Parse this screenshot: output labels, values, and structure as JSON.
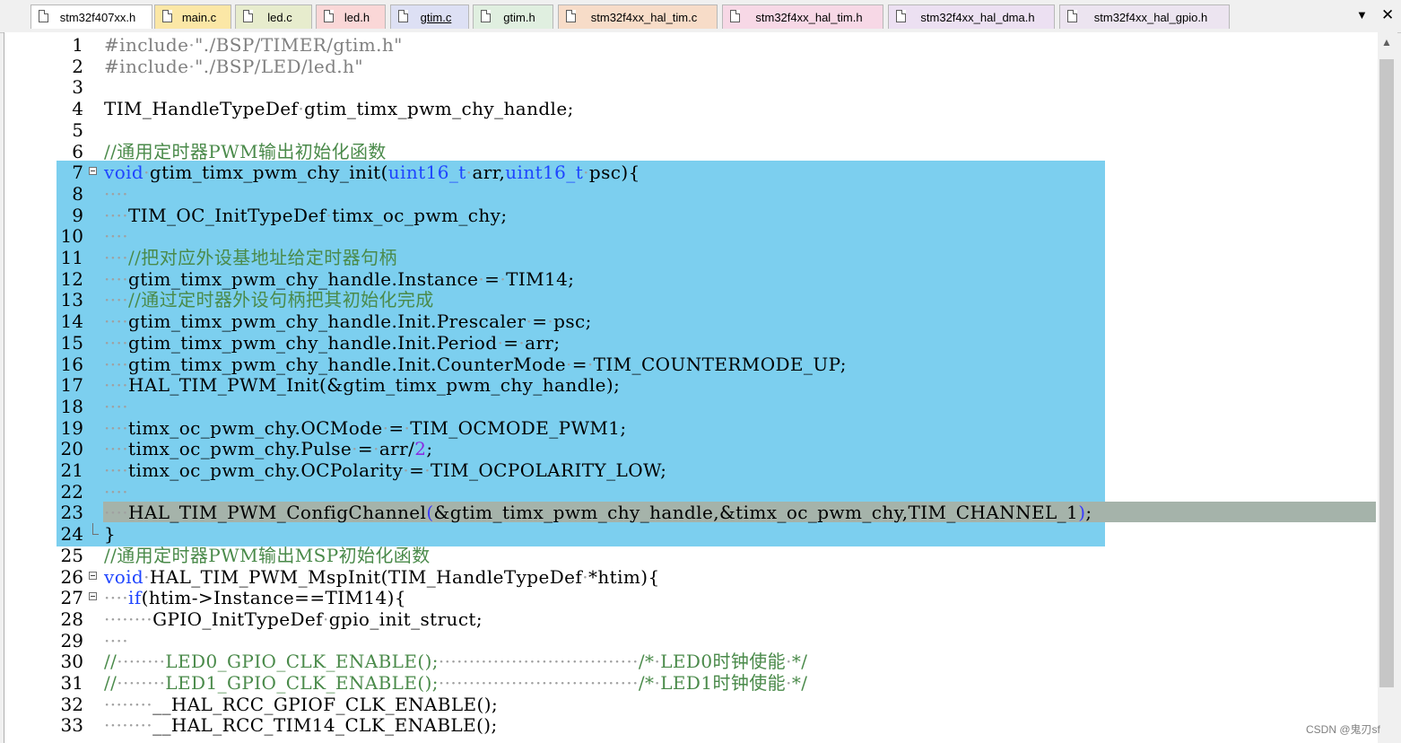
{
  "tabs": [
    {
      "label": "stm32f407xx.h",
      "color": "#ffffff",
      "active": false
    },
    {
      "label": "main.c",
      "color": "#fbe7a6",
      "active": false
    },
    {
      "label": "led.c",
      "color": "#e7eccd",
      "active": false
    },
    {
      "label": "led.h",
      "color": "#fad7d7",
      "active": false
    },
    {
      "label": "gtim.c",
      "color": "#dde0f4",
      "active": true
    },
    {
      "label": "gtim.h",
      "color": "#e0efe0",
      "active": false
    },
    {
      "label": "stm32f4xx_hal_tim.c",
      "color": "#f7dcc8",
      "active": false
    },
    {
      "label": "stm32f4xx_hal_tim.h",
      "color": "#f7d8e6",
      "active": false
    },
    {
      "label": "stm32f4xx_hal_dma.h",
      "color": "#ece0f2",
      "active": false
    },
    {
      "label": "stm32f4xx_hal_gpio.h",
      "color": "#ece4f0",
      "active": false
    }
  ],
  "tab_dropdown_icon": "chevron-down-icon",
  "tab_close_icon": "close-icon",
  "tab_dropdown_glyph": "▼",
  "tab_close_glyph": "✕",
  "line_numbers": [
    "1",
    "2",
    "3",
    "4",
    "5",
    "6",
    "7",
    "8",
    "9",
    "10",
    "11",
    "12",
    "13",
    "14",
    "15",
    "16",
    "17",
    "18",
    "19",
    "20",
    "21",
    "22",
    "23",
    "24",
    "25",
    "26",
    "27",
    "28",
    "29",
    "30",
    "31",
    "32",
    "33"
  ],
  "code_lines": [
    [
      {
        "t": "#include",
        "c": "pp"
      },
      {
        "t": "·",
        "c": "ws"
      },
      {
        "t": "\"./BSP/TIMER/gtim.h\"",
        "c": "str"
      }
    ],
    [
      {
        "t": "#include",
        "c": "pp"
      },
      {
        "t": "·",
        "c": "ws"
      },
      {
        "t": "\"./BSP/LED/led.h\"",
        "c": "str"
      }
    ],
    [],
    [
      {
        "t": "TIM_HandleTypeDef",
        "c": ""
      },
      {
        "t": "·",
        "c": "ws"
      },
      {
        "t": "gtim_timx_pwm_chy_handle;",
        "c": ""
      }
    ],
    [],
    [
      {
        "t": "//通用定时器PWM输出初始化函数",
        "c": "cm"
      }
    ],
    [
      {
        "t": "void",
        "c": "kw"
      },
      {
        "t": "·",
        "c": "ws"
      },
      {
        "t": "gtim_timx_pwm_chy_init(",
        "c": ""
      },
      {
        "t": "uint16_t",
        "c": "kw"
      },
      {
        "t": "·",
        "c": "ws"
      },
      {
        "t": "arr,",
        "c": ""
      },
      {
        "t": "uint16_t",
        "c": "kw"
      },
      {
        "t": "·",
        "c": "ws"
      },
      {
        "t": "psc){",
        "c": ""
      }
    ],
    [
      {
        "t": "····",
        "c": "ws"
      }
    ],
    [
      {
        "t": "····",
        "c": "ws"
      },
      {
        "t": "TIM_OC_InitTypeDef",
        "c": ""
      },
      {
        "t": "·",
        "c": "ws"
      },
      {
        "t": "timx_oc_pwm_chy;",
        "c": ""
      }
    ],
    [
      {
        "t": "····",
        "c": "ws"
      }
    ],
    [
      {
        "t": "····",
        "c": "ws"
      },
      {
        "t": "//把对应外设基地址给定时器句柄",
        "c": "cm"
      }
    ],
    [
      {
        "t": "····",
        "c": "ws"
      },
      {
        "t": "gtim_timx_pwm_chy_handle.Instance",
        "c": ""
      },
      {
        "t": "·",
        "c": "ws"
      },
      {
        "t": "=",
        "c": ""
      },
      {
        "t": "·",
        "c": "ws"
      },
      {
        "t": "TIM14;",
        "c": ""
      }
    ],
    [
      {
        "t": "····",
        "c": "ws"
      },
      {
        "t": "//通过定时器外设句柄把其初始化完成",
        "c": "cm"
      }
    ],
    [
      {
        "t": "····",
        "c": "ws"
      },
      {
        "t": "gtim_timx_pwm_chy_handle.Init.Prescaler",
        "c": ""
      },
      {
        "t": "·",
        "c": "ws"
      },
      {
        "t": "=",
        "c": ""
      },
      {
        "t": "·",
        "c": "ws"
      },
      {
        "t": "psc;",
        "c": ""
      }
    ],
    [
      {
        "t": "····",
        "c": "ws"
      },
      {
        "t": "gtim_timx_pwm_chy_handle.Init.Period",
        "c": ""
      },
      {
        "t": "·",
        "c": "ws"
      },
      {
        "t": "=",
        "c": ""
      },
      {
        "t": "·",
        "c": "ws"
      },
      {
        "t": "arr;",
        "c": ""
      }
    ],
    [
      {
        "t": "····",
        "c": "ws"
      },
      {
        "t": "gtim_timx_pwm_chy_handle.Init.CounterMode",
        "c": ""
      },
      {
        "t": "·",
        "c": "ws"
      },
      {
        "t": "=",
        "c": ""
      },
      {
        "t": "·",
        "c": "ws"
      },
      {
        "t": "TIM_COUNTERMODE_UP;",
        "c": ""
      }
    ],
    [
      {
        "t": "····",
        "c": "ws"
      },
      {
        "t": "HAL_TIM_PWM_Init(&gtim_timx_pwm_chy_handle);",
        "c": ""
      }
    ],
    [
      {
        "t": "····",
        "c": "ws"
      }
    ],
    [
      {
        "t": "····",
        "c": "ws"
      },
      {
        "t": "timx_oc_pwm_chy.OCMode",
        "c": ""
      },
      {
        "t": "·",
        "c": "ws"
      },
      {
        "t": "=",
        "c": ""
      },
      {
        "t": "·",
        "c": "ws"
      },
      {
        "t": "TIM_OCMODE_PWM1;",
        "c": ""
      }
    ],
    [
      {
        "t": "····",
        "c": "ws"
      },
      {
        "t": "timx_oc_pwm_chy.Pulse",
        "c": ""
      },
      {
        "t": "·",
        "c": "ws"
      },
      {
        "t": "=",
        "c": ""
      },
      {
        "t": "·",
        "c": "ws"
      },
      {
        "t": "arr/",
        "c": ""
      },
      {
        "t": "2",
        "c": "num"
      },
      {
        "t": ";",
        "c": ""
      }
    ],
    [
      {
        "t": "····",
        "c": "ws"
      },
      {
        "t": "timx_oc_pwm_chy.OCPolarity",
        "c": ""
      },
      {
        "t": "·",
        "c": "ws"
      },
      {
        "t": "=",
        "c": ""
      },
      {
        "t": "·",
        "c": "ws"
      },
      {
        "t": "TIM_OCPOLARITY_LOW;",
        "c": ""
      }
    ],
    [
      {
        "t": "····",
        "c": "ws"
      }
    ],
    [
      {
        "t": "····",
        "c": "ws"
      },
      {
        "t": "HAL_TIM_PWM_ConfigChannel",
        "c": ""
      },
      {
        "t": "(",
        "c": "brk"
      },
      {
        "t": "&gtim_timx_pwm_chy_handle,&timx_oc_pwm_chy,TIM_CHANNEL_1",
        "c": ""
      },
      {
        "t": ")",
        "c": "brk"
      },
      {
        "t": ";",
        "c": ""
      }
    ],
    [
      {
        "t": "}",
        "c": ""
      }
    ],
    [
      {
        "t": "//通用定时器PWM输出MSP初始化函数",
        "c": "cm"
      }
    ],
    [
      {
        "t": "void",
        "c": "kw"
      },
      {
        "t": "·",
        "c": "ws"
      },
      {
        "t": "HAL_TIM_PWM_MspInit(TIM_HandleTypeDef",
        "c": ""
      },
      {
        "t": "·",
        "c": "ws"
      },
      {
        "t": "*htim){",
        "c": ""
      }
    ],
    [
      {
        "t": "····",
        "c": "ws"
      },
      {
        "t": "if",
        "c": "kw"
      },
      {
        "t": "(htim->Instance==TIM14){",
        "c": ""
      }
    ],
    [
      {
        "t": "········",
        "c": "ws"
      },
      {
        "t": "GPIO_InitTypeDef",
        "c": ""
      },
      {
        "t": "·",
        "c": "ws"
      },
      {
        "t": "gpio_init_struct;",
        "c": ""
      }
    ],
    [
      {
        "t": "····",
        "c": "ws"
      }
    ],
    [
      {
        "t": "//",
        "c": "cm"
      },
      {
        "t": "········",
        "c": "ws"
      },
      {
        "t": "LED0_GPIO_CLK_ENABLE();",
        "c": "cm"
      },
      {
        "t": "·································",
        "c": "ws"
      },
      {
        "t": "/*",
        "c": "cm"
      },
      {
        "t": "·",
        "c": "ws"
      },
      {
        "t": "LED0时钟使能",
        "c": "cm"
      },
      {
        "t": "·",
        "c": "ws"
      },
      {
        "t": "*/",
        "c": "cm"
      }
    ],
    [
      {
        "t": "//",
        "c": "cm"
      },
      {
        "t": "········",
        "c": "ws"
      },
      {
        "t": "LED1_GPIO_CLK_ENABLE();",
        "c": "cm"
      },
      {
        "t": "·································",
        "c": "ws"
      },
      {
        "t": "/*",
        "c": "cm"
      },
      {
        "t": "·",
        "c": "ws"
      },
      {
        "t": "LED1时钟使能",
        "c": "cm"
      },
      {
        "t": "·",
        "c": "ws"
      },
      {
        "t": "*/",
        "c": "cm"
      }
    ],
    [
      {
        "t": "········",
        "c": "ws"
      },
      {
        "t": "__HAL_RCC_GPIOF_CLK_ENABLE();",
        "c": ""
      }
    ],
    [
      {
        "t": "········",
        "c": "ws"
      },
      {
        "t": "__HAL_RCC_TIM14_CLK_ENABLE();",
        "c": ""
      }
    ]
  ],
  "fold_start_lines": [
    7,
    26,
    27
  ],
  "fold_end_lines": [
    24
  ],
  "selected_lines": {
    "from": 7,
    "to": 24
  },
  "current_line": 23,
  "watermark": "CSDN @鬼刃sf",
  "colors": {
    "selection": "#7ccfef",
    "current_line": "#a5b3aa",
    "keyword": "#1f45ff",
    "comment": "#4a8a4a",
    "preprocessor": "#808080"
  }
}
